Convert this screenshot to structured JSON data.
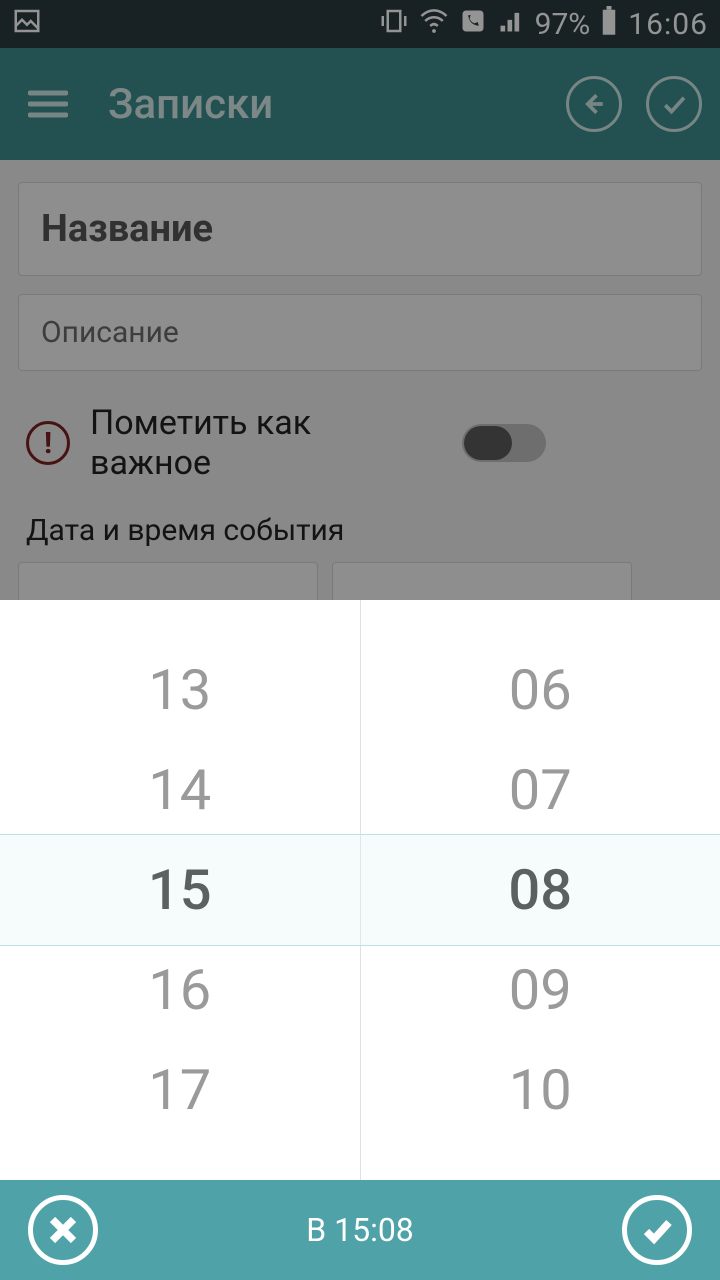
{
  "statusbar": {
    "battery_text": "97%",
    "clock": "16:06"
  },
  "header": {
    "title": "Записки"
  },
  "form": {
    "title_placeholder": "Название",
    "desc_placeholder": "Описание",
    "important_label": "Пометить как важное",
    "datetime_section_label": "Дата и время события"
  },
  "picker": {
    "hours": [
      "13",
      "14",
      "15",
      "16",
      "17"
    ],
    "minutes": [
      "06",
      "07",
      "08",
      "09",
      "10"
    ],
    "selected_hour_index": 2,
    "selected_minute_index": 2,
    "bottom_label": "В 15:08"
  }
}
